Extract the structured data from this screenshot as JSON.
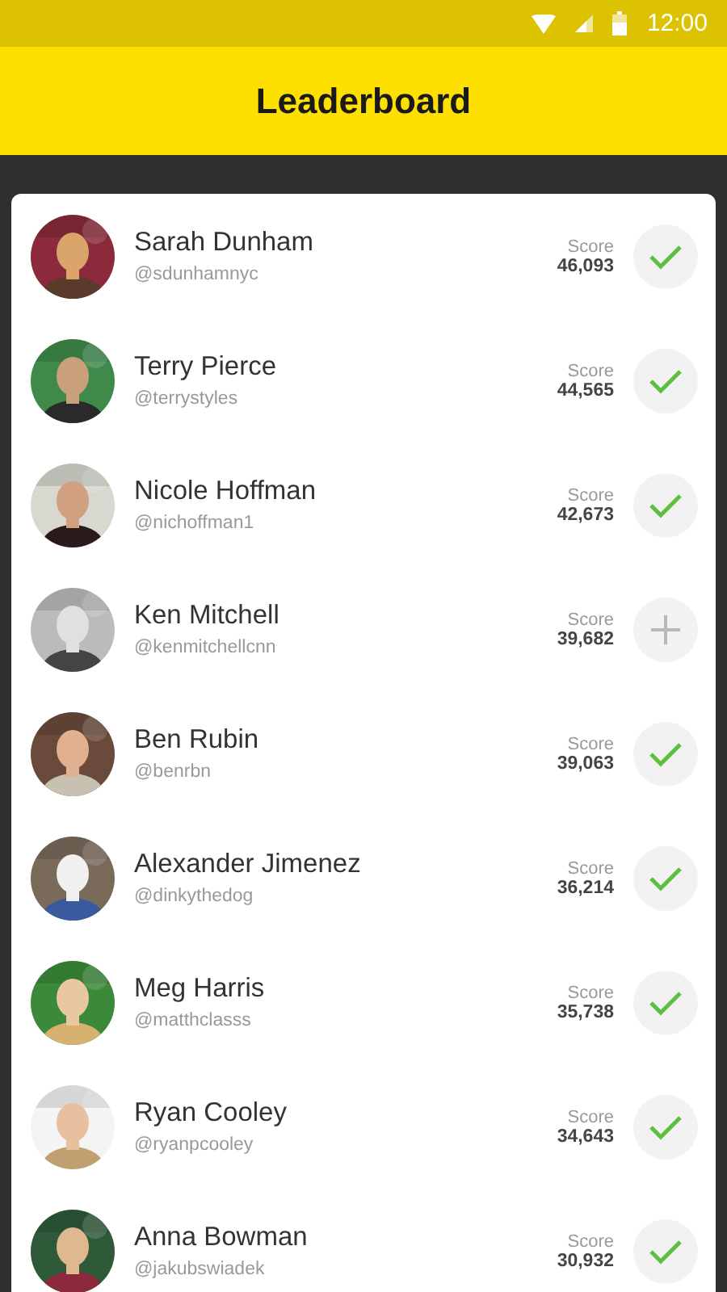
{
  "status_bar": {
    "time": "12:00"
  },
  "app_bar": {
    "title": "Leaderboard"
  },
  "players": [
    {
      "name": "Sarah Dunham",
      "handle": "@sdunhamnyc",
      "score_label": "Score",
      "score": "46,093",
      "following": true
    },
    {
      "name": "Terry Pierce",
      "handle": "@terrystyles",
      "score_label": "Score",
      "score": "44,565",
      "following": true
    },
    {
      "name": "Nicole Hoffman",
      "handle": "@nichoffman1",
      "score_label": "Score",
      "score": "42,673",
      "following": true
    },
    {
      "name": "Ken Mitchell",
      "handle": "@kenmitchellcnn",
      "score_label": "Score",
      "score": "39,682",
      "following": false
    },
    {
      "name": "Ben Rubin",
      "handle": "@benrbn",
      "score_label": "Score",
      "score": "39,063",
      "following": true
    },
    {
      "name": "Alexander Jimenez",
      "handle": "@dinkythedog",
      "score_label": "Score",
      "score": "36,214",
      "following": true
    },
    {
      "name": "Meg Harris",
      "handle": "@matthclasss",
      "score_label": "Score",
      "score": "35,738",
      "following": true
    },
    {
      "name": "Ryan Cooley",
      "handle": "@ryanpcooley",
      "score_label": "Score",
      "score": "34,643",
      "following": true
    },
    {
      "name": "Anna Bowman",
      "handle": "@jakubswiadek",
      "score_label": "Score",
      "score": "30,932",
      "following": true
    }
  ]
}
